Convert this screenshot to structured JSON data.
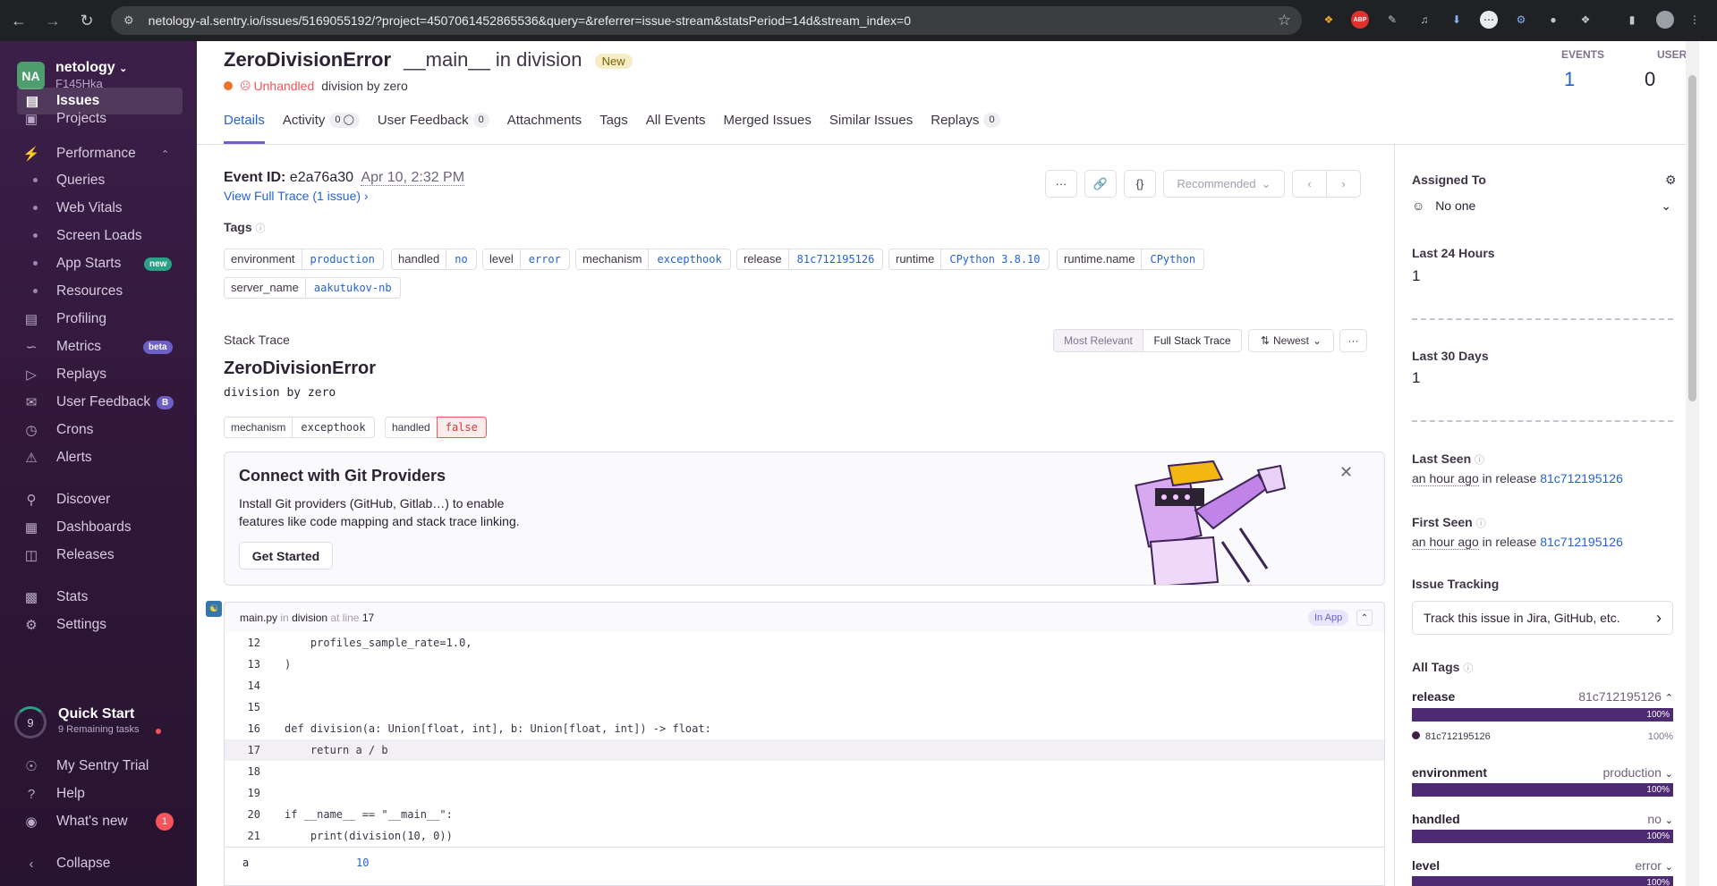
{
  "browser": {
    "url": "netology-al.sentry.io/issues/5169055192/?project=4507061452865536&query=&referrer=issue-stream&statsPeriod=14d&stream_index=0",
    "ext_abp": "ABP"
  },
  "sidebar": {
    "org_avatar": "NA",
    "org_name": "netology",
    "org_sub": "F145Hka",
    "items": [
      {
        "label": "Issues"
      },
      {
        "label": "Projects"
      },
      {
        "label": "Performance"
      },
      {
        "label": "Queries"
      },
      {
        "label": "Web Vitals"
      },
      {
        "label": "Screen Loads"
      },
      {
        "label": "App Starts",
        "badge": "new"
      },
      {
        "label": "Resources"
      },
      {
        "label": "Profiling"
      },
      {
        "label": "Metrics",
        "badge": "beta"
      },
      {
        "label": "Replays"
      },
      {
        "label": "User Feedback",
        "badge": "B"
      },
      {
        "label": "Crons"
      },
      {
        "label": "Alerts"
      },
      {
        "label": "Discover"
      },
      {
        "label": "Dashboards"
      },
      {
        "label": "Releases"
      },
      {
        "label": "Stats"
      },
      {
        "label": "Settings"
      }
    ],
    "quickstart": {
      "number": "9",
      "title": "Quick Start",
      "sub": "9 Remaining tasks"
    },
    "bottom": [
      {
        "label": "My Sentry Trial"
      },
      {
        "label": "Help"
      },
      {
        "label": "What's new",
        "badge": "1"
      },
      {
        "label": "Collapse"
      }
    ]
  },
  "issue": {
    "error": "ZeroDivisionError",
    "location": "__main__ in division",
    "status_badge": "New",
    "unhandled": "Unhandled",
    "message": "division by zero",
    "events_label": "EVENTS",
    "events_value": "1",
    "users_label": "USERS",
    "users_value": "0"
  },
  "tabs": [
    {
      "label": "Details"
    },
    {
      "label": "Activity",
      "count": "0"
    },
    {
      "label": "User Feedback",
      "count": "0"
    },
    {
      "label": "Attachments"
    },
    {
      "label": "Tags"
    },
    {
      "label": "All Events"
    },
    {
      "label": "Merged Issues"
    },
    {
      "label": "Similar Issues"
    },
    {
      "label": "Replays",
      "count": "0"
    }
  ],
  "event": {
    "id_label": "Event ID:",
    "id": "e2a76a30",
    "date": "Apr 10, 2:32 PM",
    "trace_link": "View Full Trace (1 issue)",
    "recommended": "Recommended",
    "more_btn": "···",
    "json_btn": "{}"
  },
  "tags_title": "Tags",
  "tags": [
    {
      "key": "environment",
      "value": "production"
    },
    {
      "key": "handled",
      "value": "no"
    },
    {
      "key": "level",
      "value": "error"
    },
    {
      "key": "mechanism",
      "value": "excepthook"
    },
    {
      "key": "release",
      "value": "81c712195126"
    },
    {
      "key": "runtime",
      "value": "CPython 3.8.10"
    },
    {
      "key": "runtime.name",
      "value": "CPython"
    },
    {
      "key": "server_name",
      "value": "aakutukov-nb"
    }
  ],
  "stack": {
    "title": "Stack Trace",
    "most_relevant": "Most Relevant",
    "full_stack": "Full Stack Trace",
    "newest": "Newest",
    "exception": "ZeroDivisionError",
    "message": "division by zero",
    "mech_key": "mechanism",
    "mech_val": "excepthook",
    "handled_key": "handled",
    "handled_val": "false"
  },
  "git": {
    "title": "Connect with Git Providers",
    "body1": "Install Git providers (GitHub, Gitlab…) to enable",
    "body2": "features like code mapping and stack trace linking.",
    "button": "Get Started"
  },
  "frame": {
    "file": "main.py",
    "in": "in",
    "func": "division",
    "atline": "at line",
    "line": "17",
    "inapp": "In App"
  },
  "code_lines": [
    {
      "n": "12",
      "t": "    profiles_sample_rate=1.0,"
    },
    {
      "n": "13",
      "t": ")"
    },
    {
      "n": "14",
      "t": ""
    },
    {
      "n": "15",
      "t": ""
    },
    {
      "n": "16",
      "t": "def division(a: Union[float, int], b: Union[float, int]) -> float:"
    },
    {
      "n": "17",
      "t": "    return a / b"
    },
    {
      "n": "18",
      "t": ""
    },
    {
      "n": "19",
      "t": ""
    },
    {
      "n": "20",
      "t": "if __name__ == \"__main__\":"
    },
    {
      "n": "21",
      "t": "    print(division(10, 0))"
    }
  ],
  "var": {
    "name": "a",
    "value": "10"
  },
  "right": {
    "assigned_label": "Assigned To",
    "assigned_value": "No one",
    "last24_label": "Last 24 Hours",
    "last24_value": "1",
    "last30_label": "Last 30 Days",
    "last30_value": "1",
    "lastseen_label": "Last Seen",
    "lastseen_time": "an hour ago",
    "lastseen_in": " in release ",
    "lastseen_release": "81c712195126",
    "firstseen_label": "First Seen",
    "firstseen_time": "an hour ago",
    "firstseen_in": " in release ",
    "firstseen_release": "81c712195126",
    "tracking_label": "Issue Tracking",
    "tracking_button": "Track this issue in Jira, GitHub, etc.",
    "alltags_label": "All Tags",
    "tags": [
      {
        "key": "release",
        "value": "81c712195126",
        "pct": "100%",
        "sub": "81c712195126",
        "sub_pct": "100%"
      },
      {
        "key": "environment",
        "value": "production",
        "pct": "100%"
      },
      {
        "key": "handled",
        "value": "no",
        "pct": "100%"
      },
      {
        "key": "level",
        "value": "error",
        "pct": "100%"
      }
    ]
  },
  "colors": {
    "accent": "#6c5fc7",
    "link": "#2562d4",
    "sidebar": "#3b1f49",
    "error": "#f55459"
  }
}
